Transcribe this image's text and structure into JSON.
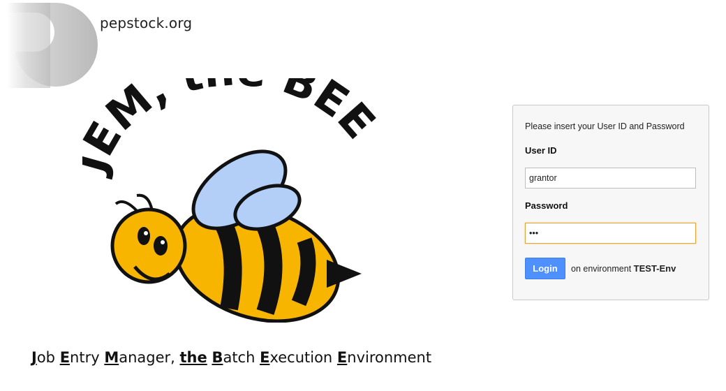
{
  "header": {
    "site_name": "pepstock.org"
  },
  "hero": {
    "logo_text": "JEM, the BEE",
    "tagline": [
      {
        "cap": "J",
        "rest": "ob "
      },
      {
        "cap": "E",
        "rest": "ntry "
      },
      {
        "cap": "M",
        "rest": "anager, "
      },
      {
        "the": "the",
        "rest": " "
      },
      {
        "cap": "B",
        "rest": "atch "
      },
      {
        "cap": "E",
        "rest": "xecution "
      },
      {
        "cap": "E",
        "rest": "nvironment"
      }
    ]
  },
  "login": {
    "prompt": "Please insert your User ID and Password",
    "userid_label": "User ID",
    "userid_value": "grantor",
    "password_label": "Password",
    "password_value": "•••",
    "button_label": "Login",
    "env_prefix": "on environment",
    "env_name": "TEST-Env"
  },
  "colors": {
    "accent": "#4d90fe",
    "focus": "#e1a73a",
    "bee_yellow": "#f7b500",
    "wing": "#b3cff7"
  }
}
